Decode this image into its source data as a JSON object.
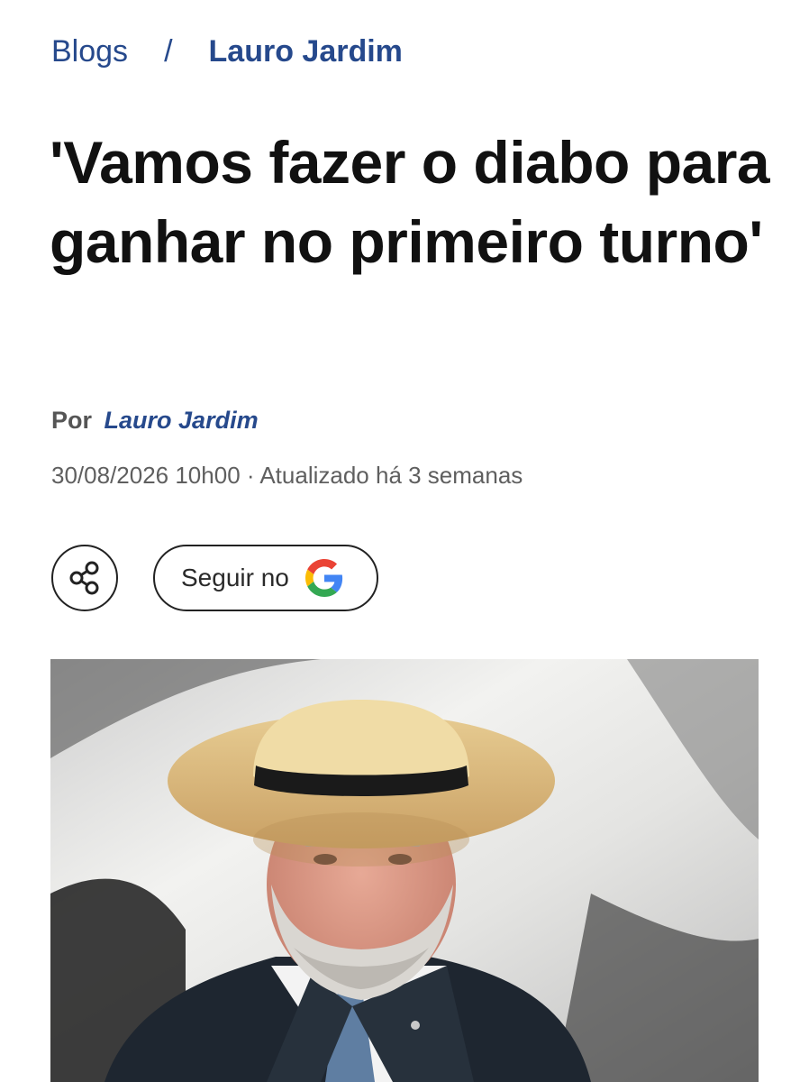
{
  "breadcrumb": {
    "section": "Blogs",
    "separator": "/",
    "current": "Lauro Jardim"
  },
  "article": {
    "headline": "'Vamos fazer o diabo para ganhar no primeiro turno'",
    "byline_prefix": "Por",
    "author": "Lauro Jardim",
    "published": "30/08/2026 10h00",
    "updated": "· Atualizado há 3 semanas"
  },
  "actions": {
    "share_icon": "share-icon",
    "follow_label": "Seguir no",
    "follow_icon": "google-g-icon"
  },
  "photo": {
    "subject": "man-in-straw-hat"
  },
  "colors": {
    "link_blue": "#26498c",
    "headline": "#111111",
    "meta_gray": "#5f5f5f"
  }
}
